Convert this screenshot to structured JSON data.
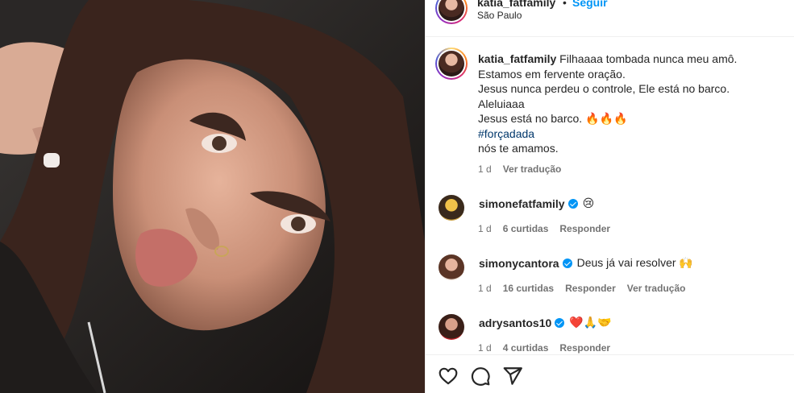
{
  "post": {
    "author": "katia_fatfamily",
    "separator": "•",
    "follow_label": "Seguir",
    "location": "São Paulo"
  },
  "caption": {
    "author": "katia_fatfamily",
    "text": "Filhaaaa tombada nunca meu amô.",
    "lines": [
      "Estamos em fervente oração.",
      "Jesus nunca perdeu o controle, Ele está no barco.",
      "Aleluiaaa",
      "Jesus está no barco. 🔥🔥🔥"
    ],
    "hashtag": "#forçadada",
    "closing": "nós te amamos.",
    "time": "1 d",
    "translate": "Ver tradução"
  },
  "comments": [
    {
      "user": "simonefatfamily",
      "verified": true,
      "text": "😢",
      "time": "1 d",
      "likes": "6 curtidas",
      "reply": "Responder",
      "translate": ""
    },
    {
      "user": "simonycantora",
      "verified": true,
      "text": "Deus já vai resolver 🙌",
      "time": "1 d",
      "likes": "16 curtidas",
      "reply": "Responder",
      "translate": "Ver tradução"
    },
    {
      "user": "adrysantos10",
      "verified": true,
      "text": "❤️🙏🤝",
      "time": "1 d",
      "likes": "4 curtidas",
      "reply": "Responder",
      "translate": ""
    }
  ],
  "actions": {
    "like_icon": "heart-icon",
    "comment_icon": "comment-icon",
    "share_icon": "share-icon"
  },
  "colors": {
    "link": "#0095f6",
    "hashtag": "#00376b",
    "muted": "#737373",
    "text": "#262626"
  }
}
